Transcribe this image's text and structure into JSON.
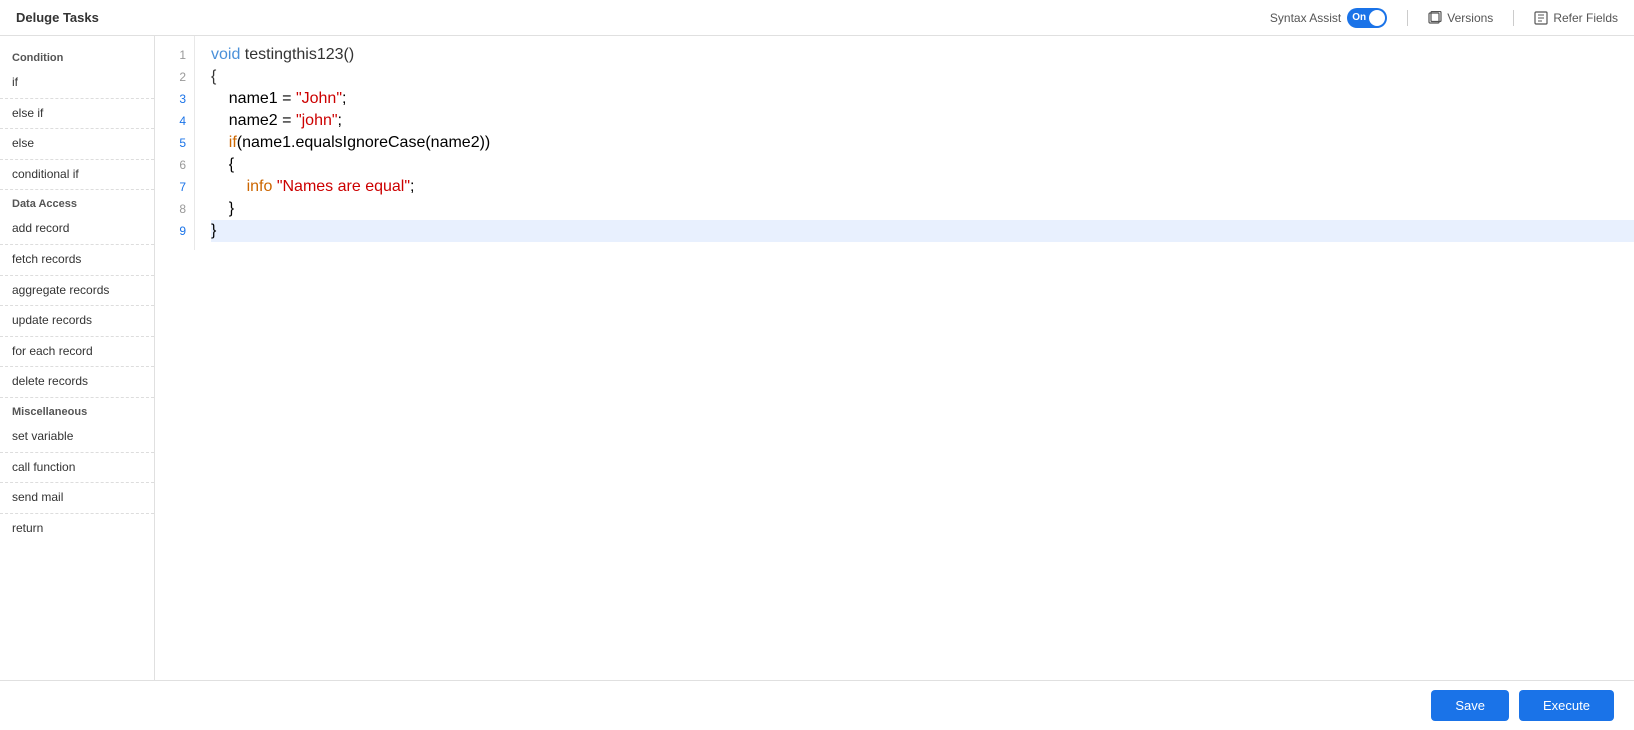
{
  "app": {
    "title": "Deluge Tasks"
  },
  "header": {
    "syntax_assist_label": "Syntax Assist",
    "toggle_label": "On",
    "versions_label": "Versions",
    "refer_fields_label": "Refer Fields"
  },
  "sidebar": {
    "condition_title": "Condition",
    "items_condition": [
      {
        "label": "if"
      },
      {
        "label": "else if"
      },
      {
        "label": "else"
      },
      {
        "label": "conditional if"
      }
    ],
    "data_access_title": "Data Access",
    "items_data_access": [
      {
        "label": "add record"
      },
      {
        "label": "fetch records"
      },
      {
        "label": "aggregate records"
      },
      {
        "label": "update records"
      },
      {
        "label": "for each record"
      },
      {
        "label": "delete records"
      }
    ],
    "miscellaneous_title": "Miscellaneous",
    "items_misc": [
      {
        "label": "set variable"
      },
      {
        "label": "call function"
      },
      {
        "label": "send mail"
      },
      {
        "label": "return"
      }
    ]
  },
  "code": {
    "lines": [
      {
        "num": 1,
        "content": "void testingthis123()",
        "highlighted": false
      },
      {
        "num": 2,
        "content": "{",
        "highlighted": false
      },
      {
        "num": 3,
        "content": "    name1 = \"John\";",
        "highlighted": false
      },
      {
        "num": 4,
        "content": "    name2 = \"john\";",
        "highlighted": false
      },
      {
        "num": 5,
        "content": "    if(name1.equalsIgnoreCase(name2))",
        "highlighted": false
      },
      {
        "num": 6,
        "content": "    {",
        "highlighted": false
      },
      {
        "num": 7,
        "content": "        info \"Names are equal\";",
        "highlighted": false
      },
      {
        "num": 8,
        "content": "    }",
        "highlighted": false
      },
      {
        "num": 9,
        "content": "}",
        "highlighted": true
      }
    ]
  },
  "footer": {
    "save_label": "Save",
    "execute_label": "Execute"
  }
}
